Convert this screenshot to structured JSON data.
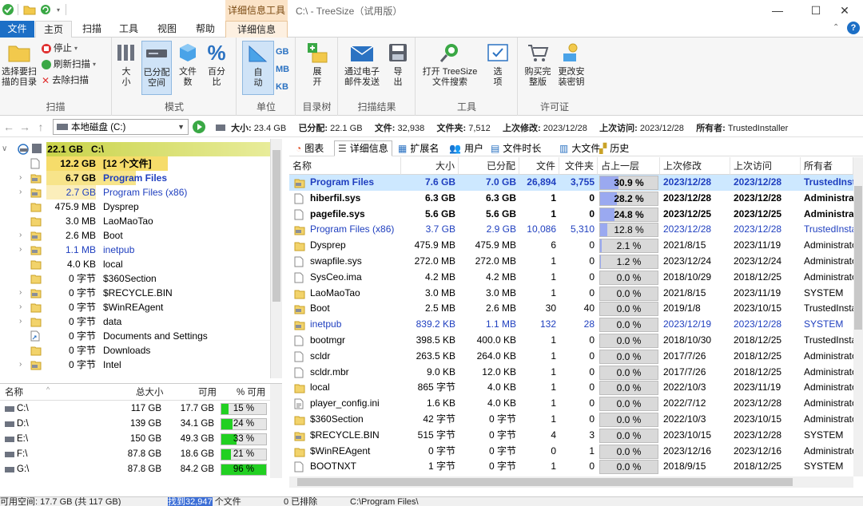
{
  "window": {
    "title": "C:\\ - TreeSize（试用版）",
    "context_tab_title": "详细信息工具"
  },
  "tabs": {
    "file": "文件",
    "home": "主页",
    "scan": "扫描",
    "tools": "工具",
    "view": "视图",
    "help": "帮助",
    "details": "详细信息"
  },
  "ribbon": {
    "scan": {
      "label": "扫描",
      "select_dir": [
        "选择要扫",
        "描的目录"
      ],
      "stop": "停止",
      "refresh": "刷新扫描",
      "remove": "去除扫描"
    },
    "mode": {
      "label": "模式",
      "size": [
        "大",
        "小"
      ],
      "allocated": [
        "已分配",
        "空间"
      ],
      "files": [
        "文件",
        "数"
      ],
      "percent": [
        "百分",
        "比"
      ]
    },
    "unit": {
      "label": "单位",
      "auto": [
        "自",
        "动"
      ],
      "gb": "GB",
      "mb": "MB",
      "kb": "KB"
    },
    "tree": {
      "label": "目录树",
      "expand": [
        "展",
        "开"
      ]
    },
    "results": {
      "label": "扫描结果",
      "mail": [
        "通过电子",
        "邮件发送"
      ],
      "export": [
        "导",
        "出"
      ]
    },
    "tools": {
      "label": "工具",
      "open_search": [
        "打开 TreeSize",
        "文件搜索"
      ],
      "options": [
        "选",
        "项"
      ]
    },
    "license": {
      "label": "许可证",
      "buy": [
        "购买完",
        "整版"
      ],
      "change_key": [
        "更改安",
        "装密钥"
      ]
    }
  },
  "address": {
    "drive": "本地磁盘 (C:)",
    "size_lbl": "大小:",
    "size": "23.4 GB",
    "alloc_lbl": "已分配:",
    "alloc": "22.1 GB",
    "files_lbl": "文件:",
    "files": "32,938",
    "folders_lbl": "文件夹:",
    "folders": "7,512",
    "modified_lbl": "上次修改:",
    "modified": "2023/12/28",
    "accessed_lbl": "上次访问:",
    "accessed": "2023/12/28",
    "owner_lbl": "所有者:",
    "owner": "TrustedInstaller"
  },
  "tree": [
    {
      "size": "22.1 GB",
      "name": "C:\\",
      "level": 0,
      "icon": "drive",
      "hl": "root",
      "exp": "v"
    },
    {
      "size": "12.2 GB",
      "name": "[12 个文件]",
      "level": 1,
      "icon": "file",
      "hl": "big",
      "exp": ""
    },
    {
      "size": "6.7 GB",
      "name": "Program Files",
      "level": 1,
      "icon": "folder-sys",
      "hl": "med",
      "exp": ">"
    },
    {
      "size": "2.7 GB",
      "name": "Program Files (x86)",
      "level": 1,
      "icon": "folder-sys",
      "hl": "small",
      "exp": ">"
    },
    {
      "size": "475.9 MB",
      "name": "Dysprep",
      "level": 1,
      "icon": "folder",
      "hl": "",
      "exp": ""
    },
    {
      "size": "3.0 MB",
      "name": "LaoMaoTao",
      "level": 1,
      "icon": "folder",
      "hl": "",
      "exp": ""
    },
    {
      "size": "2.6 MB",
      "name": "Boot",
      "level": 1,
      "icon": "folder-sys",
      "hl": "",
      "exp": ">"
    },
    {
      "size": "1.1 MB",
      "name": "inetpub",
      "level": 1,
      "icon": "folder-sys",
      "hl": "",
      "exp": ">",
      "blue": true
    },
    {
      "size": "4.0 KB",
      "name": "local",
      "level": 1,
      "icon": "folder",
      "hl": "",
      "exp": ""
    },
    {
      "size": "0 字节",
      "name": "$360Section",
      "level": 1,
      "icon": "folder",
      "hl": "",
      "exp": ""
    },
    {
      "size": "0 字节",
      "name": "$RECYCLE.BIN",
      "level": 1,
      "icon": "folder-sys",
      "hl": "",
      "exp": ">"
    },
    {
      "size": "0 字节",
      "name": "$WinREAgent",
      "level": 1,
      "icon": "folder",
      "hl": "",
      "exp": ">"
    },
    {
      "size": "0 字节",
      "name": "data",
      "level": 1,
      "icon": "folder",
      "hl": "",
      "exp": ">"
    },
    {
      "size": "0 字节",
      "name": "Documents and Settings",
      "level": 1,
      "icon": "link",
      "hl": "",
      "exp": ""
    },
    {
      "size": "0 字节",
      "name": "Downloads",
      "level": 1,
      "icon": "folder",
      "hl": "",
      "exp": ""
    },
    {
      "size": "0 字节",
      "name": "Intel",
      "level": 1,
      "icon": "folder-sys",
      "hl": "",
      "exp": ">"
    }
  ],
  "drives": {
    "headers": {
      "name": "名称",
      "total": "总大小",
      "free": "可用",
      "pct": "% 可用"
    },
    "rows": [
      {
        "name": "C:\\",
        "total": "117 GB",
        "free": "17.7 GB",
        "pct": "15 %",
        "frac": 0.15
      },
      {
        "name": "D:\\",
        "total": "139 GB",
        "free": "34.1 GB",
        "pct": "24 %",
        "frac": 0.24
      },
      {
        "name": "E:\\",
        "total": "150 GB",
        "free": "49.3 GB",
        "pct": "33 %",
        "frac": 0.33
      },
      {
        "name": "F:\\",
        "total": "87.8 GB",
        "free": "18.6 GB",
        "pct": "21 %",
        "frac": 0.21
      },
      {
        "name": "G:\\",
        "total": "87.8 GB",
        "free": "84.2 GB",
        "pct": "96 %",
        "frac": 0.96
      }
    ]
  },
  "right_tabs": [
    "图表",
    "详细信息",
    "扩展名",
    "用户",
    "文件时长",
    "大文件",
    "历史"
  ],
  "table": {
    "headers": {
      "name": "名称",
      "size": "大小",
      "alloc": "已分配",
      "files": "文件",
      "folders": "文件夹",
      "pct": "占上一层 %...",
      "modified": "上次修改",
      "accessed": "上次访问",
      "owner": "所有者"
    },
    "rows": [
      {
        "name": "Program Files",
        "size": "7.6 GB",
        "alloc": "7.0 GB",
        "files": "26,894",
        "folders": "3,755",
        "pct": "30.9 %",
        "frac": 0.309,
        "modified": "2023/12/28",
        "accessed": "2023/12/28",
        "owner": "TrustedInstaller",
        "icon": "folder-sys",
        "style": "bold-blue",
        "sel": true
      },
      {
        "name": "hiberfil.sys",
        "size": "6.3 GB",
        "alloc": "6.3 GB",
        "files": "1",
        "folders": "0",
        "pct": "28.2 %",
        "frac": 0.282,
        "modified": "2023/12/28",
        "accessed": "2023/12/28",
        "owner": "Administrators",
        "icon": "file",
        "style": "bold"
      },
      {
        "name": "pagefile.sys",
        "size": "5.6 GB",
        "alloc": "5.6 GB",
        "files": "1",
        "folders": "0",
        "pct": "24.8 %",
        "frac": 0.248,
        "modified": "2023/12/25",
        "accessed": "2023/12/25",
        "owner": "Administrators",
        "icon": "file",
        "style": "bold"
      },
      {
        "name": "Program Files (x86)",
        "size": "3.7 GB",
        "alloc": "2.9 GB",
        "files": "10,086",
        "folders": "5,310",
        "pct": "12.8 %",
        "frac": 0.128,
        "modified": "2023/12/28",
        "accessed": "2023/12/28",
        "owner": "TrustedInstaller",
        "icon": "folder-sys",
        "style": "blue"
      },
      {
        "name": "Dysprep",
        "size": "475.9 MB",
        "alloc": "475.9 MB",
        "files": "6",
        "folders": "0",
        "pct": "2.1 %",
        "frac": 0.021,
        "modified": "2021/8/15",
        "accessed": "2023/11/19",
        "owner": "Administrators",
        "icon": "folder",
        "style": ""
      },
      {
        "name": "swapfile.sys",
        "size": "272.0 MB",
        "alloc": "272.0 MB",
        "files": "1",
        "folders": "0",
        "pct": "1.2 %",
        "frac": 0.012,
        "modified": "2023/12/24",
        "accessed": "2023/12/24",
        "owner": "Administrators",
        "icon": "file",
        "style": ""
      },
      {
        "name": "SysCeo.ima",
        "size": "4.2 MB",
        "alloc": "4.2 MB",
        "files": "1",
        "folders": "0",
        "pct": "0.0 %",
        "frac": 0,
        "modified": "2018/10/29",
        "accessed": "2018/12/25",
        "owner": "Administrators",
        "icon": "file",
        "style": ""
      },
      {
        "name": "LaoMaoTao",
        "size": "3.0 MB",
        "alloc": "3.0 MB",
        "files": "1",
        "folders": "0",
        "pct": "0.0 %",
        "frac": 0,
        "modified": "2021/8/15",
        "accessed": "2023/11/19",
        "owner": "SYSTEM",
        "icon": "folder",
        "style": ""
      },
      {
        "name": "Boot",
        "size": "2.5 MB",
        "alloc": "2.6 MB",
        "files": "30",
        "folders": "40",
        "pct": "0.0 %",
        "frac": 0,
        "modified": "2019/1/8",
        "accessed": "2023/10/15",
        "owner": "TrustedInstaller",
        "icon": "folder-sys",
        "style": ""
      },
      {
        "name": "inetpub",
        "size": "839.2 KB",
        "alloc": "1.1 MB",
        "files": "132",
        "folders": "28",
        "pct": "0.0 %",
        "frac": 0,
        "modified": "2023/12/19",
        "accessed": "2023/12/28",
        "owner": "SYSTEM",
        "icon": "folder-sys",
        "style": "blue"
      },
      {
        "name": "bootmgr",
        "size": "398.5 KB",
        "alloc": "400.0 KB",
        "files": "1",
        "folders": "0",
        "pct": "0.0 %",
        "frac": 0,
        "modified": "2018/10/30",
        "accessed": "2018/12/25",
        "owner": "TrustedInstaller",
        "icon": "file",
        "style": ""
      },
      {
        "name": "scldr",
        "size": "263.5 KB",
        "alloc": "264.0 KB",
        "files": "1",
        "folders": "0",
        "pct": "0.0 %",
        "frac": 0,
        "modified": "2017/7/26",
        "accessed": "2018/12/25",
        "owner": "Administrators",
        "icon": "file",
        "style": ""
      },
      {
        "name": "scldr.mbr",
        "size": "9.0 KB",
        "alloc": "12.0 KB",
        "files": "1",
        "folders": "0",
        "pct": "0.0 %",
        "frac": 0,
        "modified": "2017/7/26",
        "accessed": "2018/12/25",
        "owner": "Administrators",
        "icon": "file",
        "style": ""
      },
      {
        "name": "local",
        "size": "865 字节",
        "alloc": "4.0 KB",
        "files": "1",
        "folders": "0",
        "pct": "0.0 %",
        "frac": 0,
        "modified": "2022/10/3",
        "accessed": "2023/11/19",
        "owner": "Administrators",
        "icon": "folder",
        "style": ""
      },
      {
        "name": "player_config.ini",
        "size": "1.6 KB",
        "alloc": "4.0 KB",
        "files": "1",
        "folders": "0",
        "pct": "0.0 %",
        "frac": 0,
        "modified": "2022/7/12",
        "accessed": "2023/12/28",
        "owner": "Administrators",
        "icon": "ini",
        "style": ""
      },
      {
        "name": "$360Section",
        "size": "42 字节",
        "alloc": "0 字节",
        "files": "1",
        "folders": "0",
        "pct": "0.0 %",
        "frac": 0,
        "modified": "2022/10/3",
        "accessed": "2023/10/15",
        "owner": "Administrators",
        "icon": "folder",
        "style": ""
      },
      {
        "name": "$RECYCLE.BIN",
        "size": "515 字节",
        "alloc": "0 字节",
        "files": "4",
        "folders": "3",
        "pct": "0.0 %",
        "frac": 0,
        "modified": "2023/10/15",
        "accessed": "2023/12/28",
        "owner": "SYSTEM",
        "icon": "folder-sys",
        "style": ""
      },
      {
        "name": "$WinREAgent",
        "size": "0 字节",
        "alloc": "0 字节",
        "files": "0",
        "folders": "1",
        "pct": "0.0 %",
        "frac": 0,
        "modified": "2023/12/16",
        "accessed": "2023/12/16",
        "owner": "Administrators",
        "icon": "folder",
        "style": ""
      },
      {
        "name": "BOOTNXT",
        "size": "1 字节",
        "alloc": "0 字节",
        "files": "1",
        "folders": "0",
        "pct": "0.0 %",
        "frac": 0,
        "modified": "2018/9/15",
        "accessed": "2018/12/25",
        "owner": "SYSTEM",
        "icon": "file",
        "style": ""
      }
    ]
  },
  "status": {
    "free": "可用空间: 17.7 GB (共 117 GB)",
    "found_pre": "找到",
    "found_num": "32,947",
    "found_post": "个文件",
    "excluded": "0 已排除",
    "path": "C:\\Program Files\\"
  },
  "colors": {
    "accent": "#1c6fc6",
    "selection": "#cde8ff",
    "bar_fill": "#9aa9f0",
    "tree_root": "#c9d34a",
    "tree_big": "#f6dc6a",
    "drive_bar": "#22d022"
  }
}
